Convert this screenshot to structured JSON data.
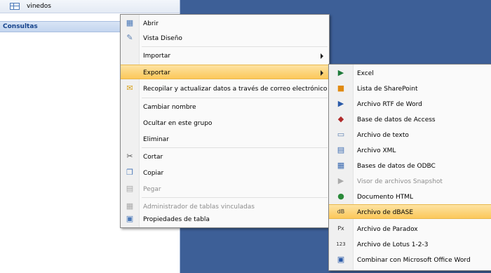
{
  "nav": {
    "table_label": "vinedos",
    "group_label": "Consultas"
  },
  "context_menu": {
    "items": [
      {
        "label": "Abrir",
        "icon": "open-table-icon"
      },
      {
        "label": "Vista Diseño",
        "icon": "design-view-icon"
      },
      {
        "label": "Importar",
        "icon": "",
        "submenu": true
      },
      {
        "label": "Exportar",
        "icon": "",
        "submenu": true,
        "highlighted": true
      },
      {
        "label": "Recopilar y actualizar datos a través de correo electrónico",
        "icon": "collect-data-icon"
      },
      {
        "label": "Cambiar nombre",
        "icon": ""
      },
      {
        "label": "Ocultar en este grupo",
        "icon": ""
      },
      {
        "label": "Eliminar",
        "icon": ""
      },
      {
        "label": "Cortar",
        "icon": "scissors-icon"
      },
      {
        "label": "Copiar",
        "icon": "copy-icon"
      },
      {
        "label": "Pegar",
        "icon": "paste-icon",
        "disabled": true
      },
      {
        "label": "Administrador de tablas vinculadas",
        "icon": "linked-tables-icon",
        "disabled": true
      },
      {
        "label": "Propiedades de tabla",
        "icon": "properties-icon"
      }
    ]
  },
  "export_submenu": {
    "items": [
      {
        "label": "Excel",
        "icon": "excel-icon"
      },
      {
        "label": "Lista de SharePoint",
        "icon": "sharepoint-icon"
      },
      {
        "label": "Archivo RTF de Word",
        "icon": "word-rtf-icon"
      },
      {
        "label": "Base de datos de Access",
        "icon": "access-icon"
      },
      {
        "label": "Archivo de texto",
        "icon": "text-file-icon"
      },
      {
        "label": "Archivo XML",
        "icon": "xml-icon"
      },
      {
        "label": "Bases de datos de ODBC",
        "icon": "odbc-icon"
      },
      {
        "label": "Visor de archivos Snapshot",
        "icon": "snapshot-icon",
        "disabled": true
      },
      {
        "label": "Documento HTML",
        "icon": "html-icon"
      },
      {
        "label": "Archivo de dBASE",
        "icon": "dbase-icon",
        "highlighted": true
      },
      {
        "label": "Archivo de Paradox",
        "icon": "paradox-icon"
      },
      {
        "label": "Archivo de Lotus 1-2-3",
        "icon": "lotus-icon"
      },
      {
        "label": "Combinar con Microsoft Office Word",
        "icon": "word-merge-icon"
      }
    ]
  },
  "colors": {
    "background": "#3d5f97",
    "highlight": "#fcc85a"
  }
}
